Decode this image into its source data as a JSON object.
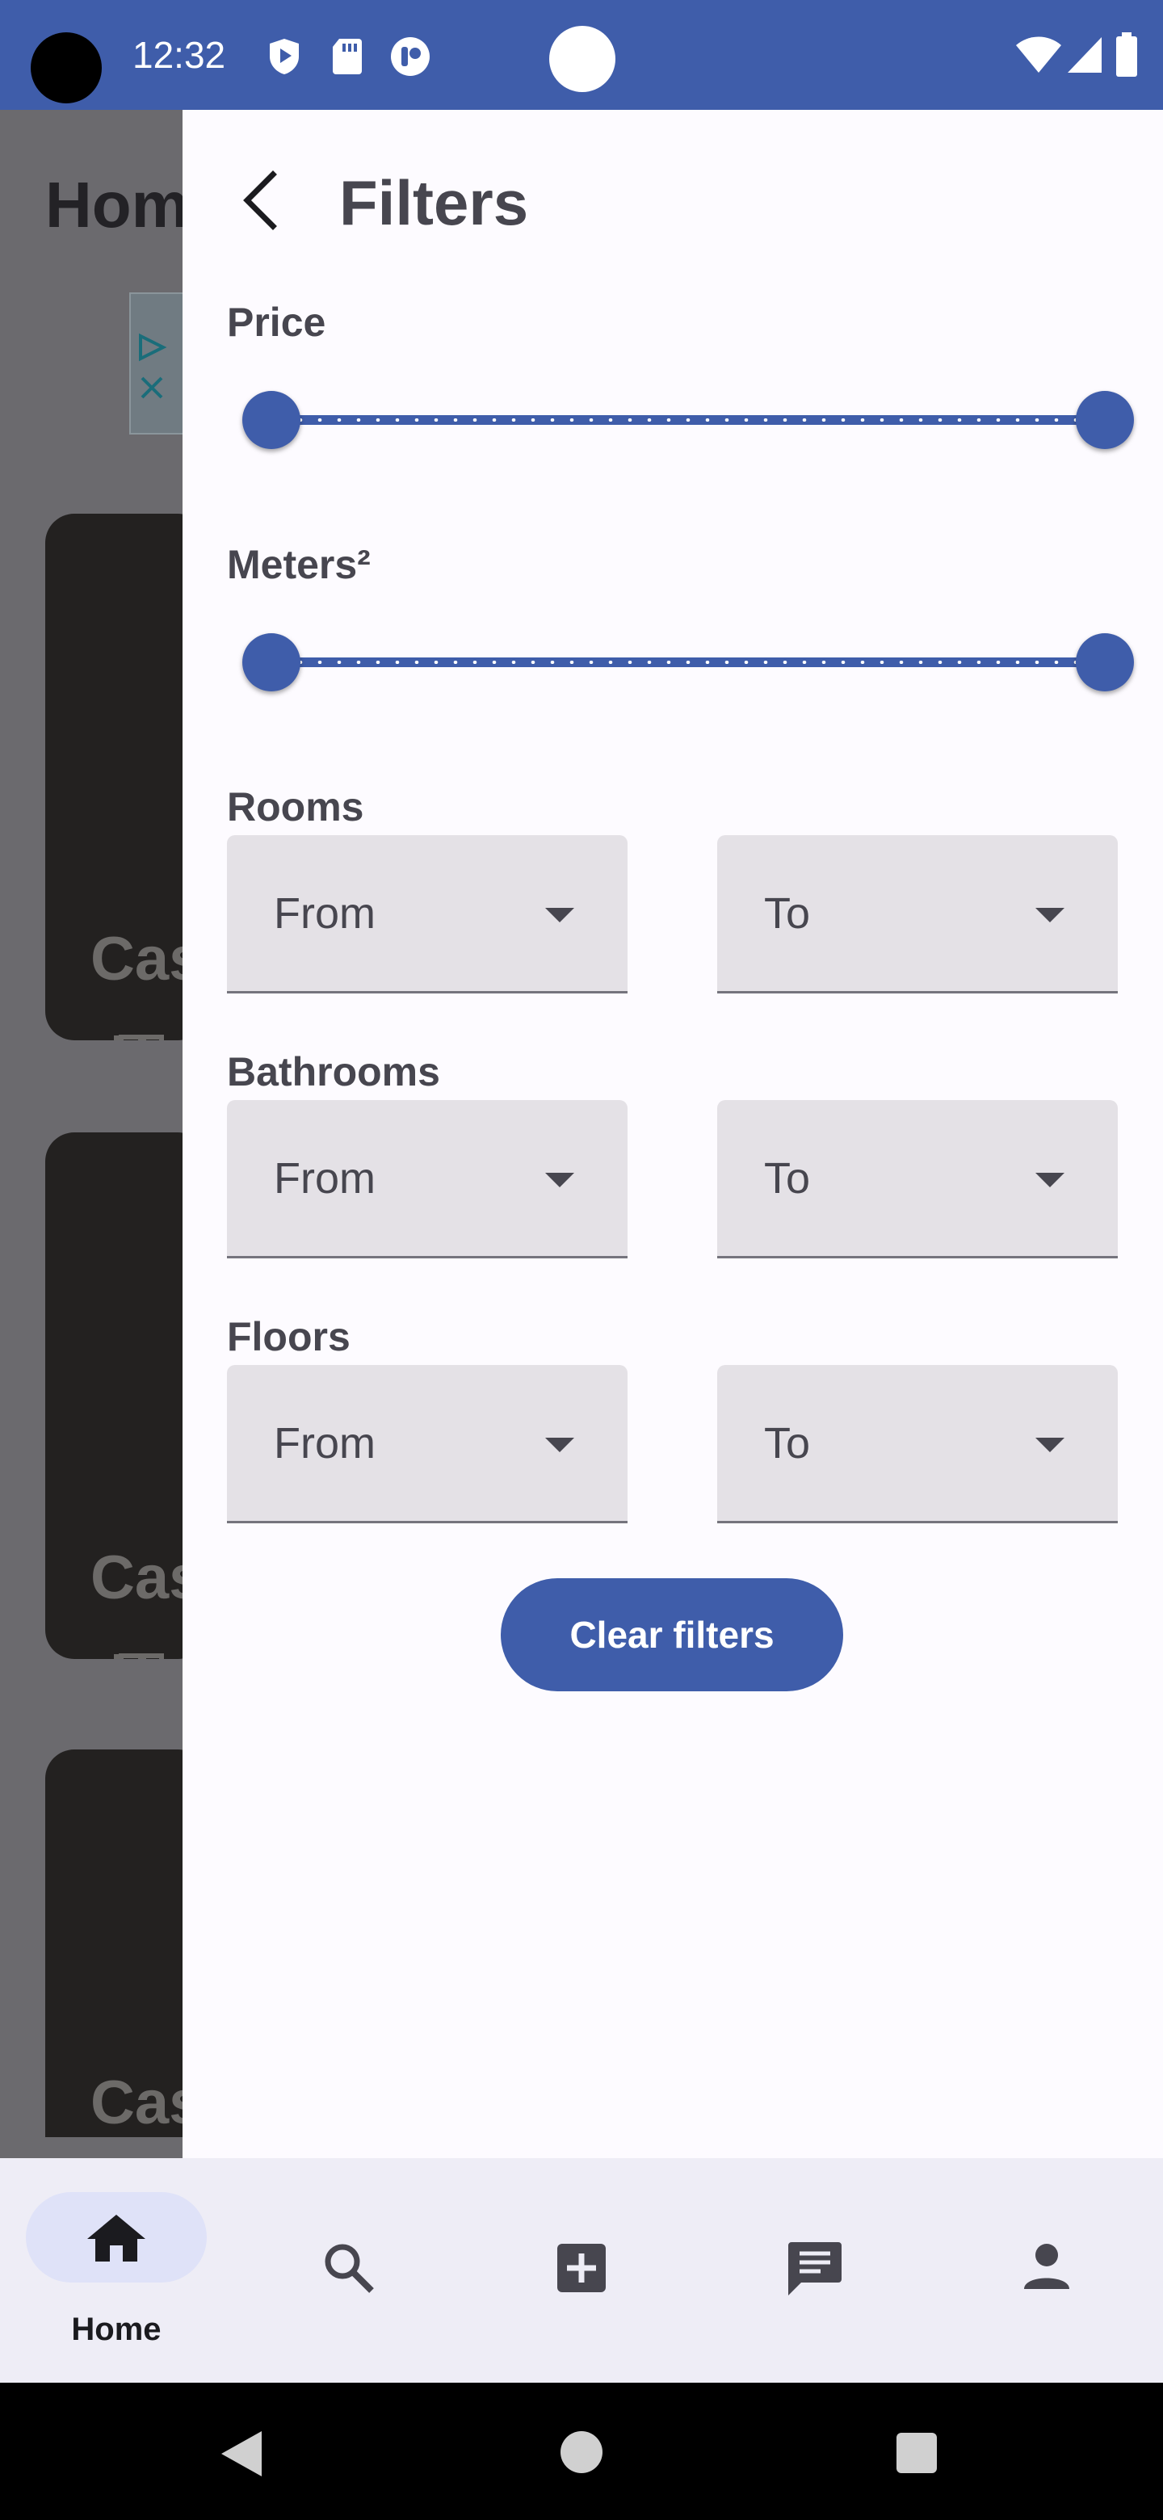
{
  "status_bar": {
    "time": "12:32"
  },
  "background_app": {
    "title": "Hom",
    "card_title_fragment": "Cas"
  },
  "filters": {
    "title": "Filters",
    "price": {
      "label": "Price",
      "range_min_fraction": 0,
      "range_max_fraction": 1
    },
    "meters": {
      "label": "Meters²",
      "range_min_fraction": 0,
      "range_max_fraction": 1
    },
    "rooms": {
      "label": "Rooms",
      "from": "From",
      "to": "To"
    },
    "bathrooms": {
      "label": "Bathrooms",
      "from": "From",
      "to": "To"
    },
    "floors": {
      "label": "Floors",
      "from": "From",
      "to": "To"
    },
    "clear_label": "Clear filters"
  },
  "bottom_nav": {
    "items": [
      {
        "name": "home",
        "label": "Home",
        "icon": "home-icon",
        "selected": true
      },
      {
        "name": "search",
        "icon": "search-icon"
      },
      {
        "name": "add",
        "icon": "add-box-icon"
      },
      {
        "name": "messages",
        "icon": "chat-icon"
      },
      {
        "name": "profile",
        "icon": "person-icon"
      }
    ]
  },
  "colors": {
    "accent": "#3f5daa",
    "field_bg": "#e4e1e6",
    "text": "#47464f",
    "nav_bg": "#eeedf6",
    "scrim": "#6b6a6e"
  }
}
